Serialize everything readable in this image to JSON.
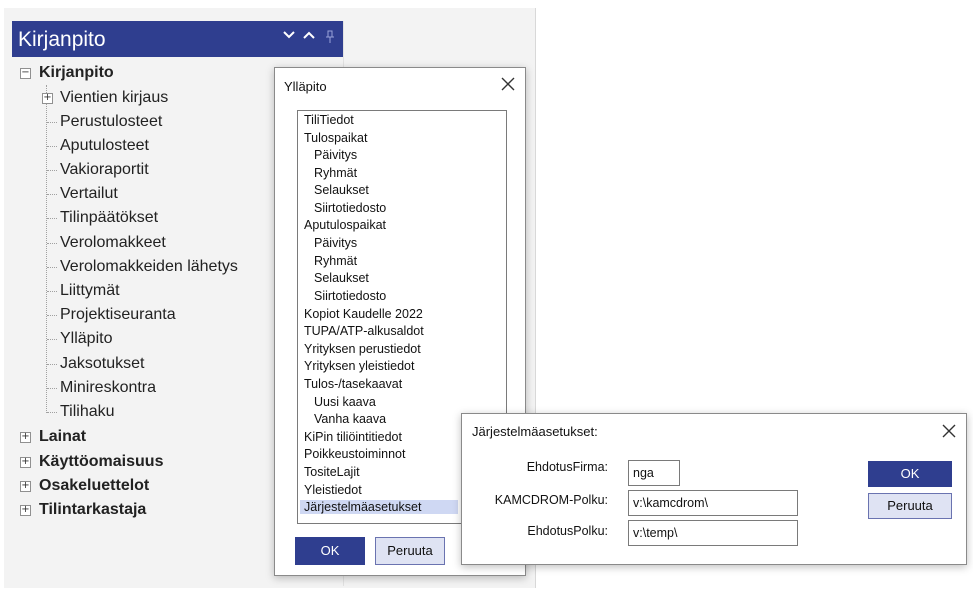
{
  "panel": {
    "title": "Kirjanpito",
    "icons": [
      "chevron-down-icon",
      "chevron-up-icon",
      "pin-icon"
    ]
  },
  "tree": {
    "root": "Kirjanpito",
    "children": [
      "Vientien kirjaus",
      "Perustulosteet",
      "Aputulosteet",
      "Vakioraportit",
      "Vertailut",
      "Tilinpäätökset",
      "Verolomakkeet",
      "Verolomakkeiden lähetys",
      "Liittymät",
      "Projektiseuranta",
      "Ylläpito",
      "Jaksotukset",
      "Minireskontra",
      "Tilihaku"
    ],
    "others": [
      "Lainat",
      "Käyttöomaisuus",
      "Osakeluettelot",
      "Tilintarkastaja"
    ]
  },
  "yllapito": {
    "title": "Ylläpito",
    "items": [
      "TiliTiedot",
      "Tulospaikat",
      "Päivitys",
      "Ryhmät",
      "Selaukset",
      "Siirtotiedosto",
      "Aputulospaikat",
      "Päivitys",
      "Ryhmät",
      "Selaukset",
      "Siirtotiedosto",
      "Kopiot Kaudelle 2022",
      "TUPA/ATP-alkusaldot",
      "Yrityksen perustiedot",
      "Yrityksen yleistiedot",
      "Tulos-/tasekaavat",
      "Uusi kaava",
      "Vanha kaava",
      "KiPin tiliöintitiedot",
      "Poikkeustoiminnot",
      "TositeLajit",
      "Yleistiedot",
      "Järjestelmäasetukset"
    ],
    "ok_label": "OK",
    "cancel_label": "Peruuta"
  },
  "settings": {
    "title": "Järjestelmäasetukset:",
    "fields": [
      {
        "label": "EhdotusFirma:",
        "value": "nga"
      },
      {
        "label": "KAMCDROM-Polku:",
        "value": "v:\\kamcdrom\\"
      },
      {
        "label": "EhdotusPolku:",
        "value": "v:\\temp\\"
      }
    ],
    "ok_label": "OK",
    "cancel_label": "Peruuta"
  },
  "colors": {
    "accent": "#2f3e8f",
    "selection": "#cfd8f3"
  }
}
